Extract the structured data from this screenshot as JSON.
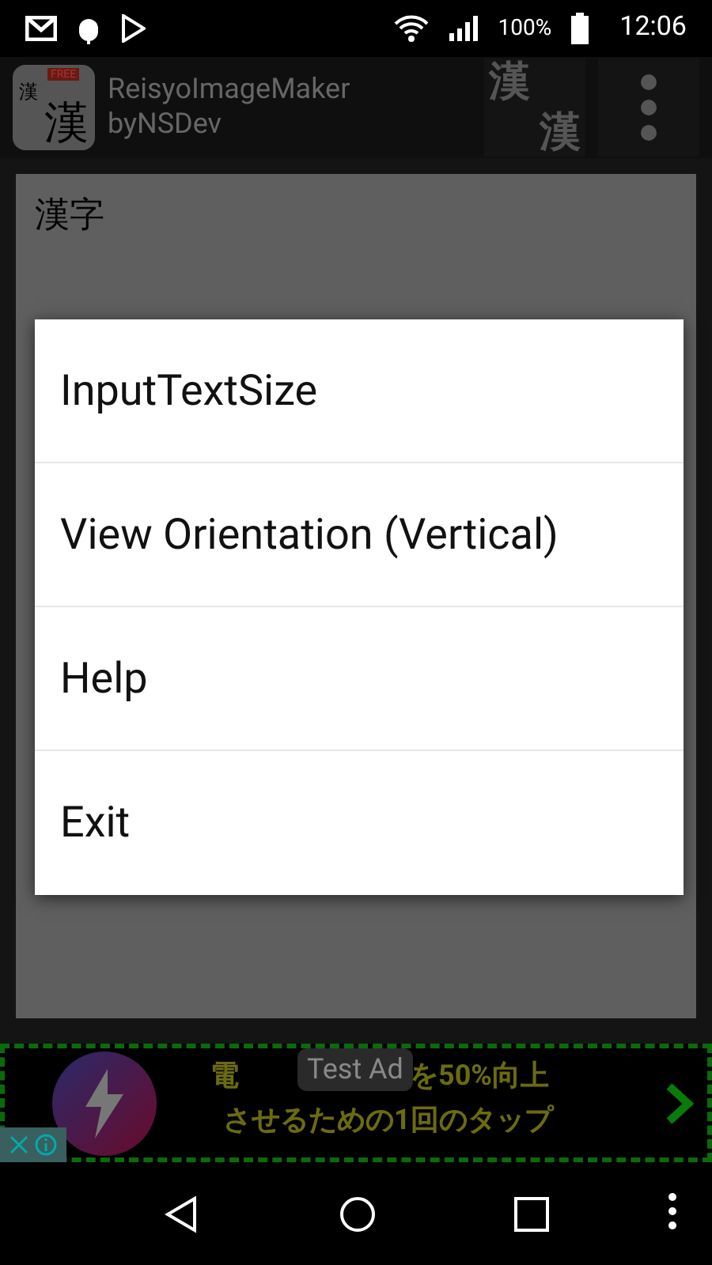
{
  "status_bar": {
    "battery_text": "100%",
    "time": "12:06"
  },
  "action_bar": {
    "app_icon": {
      "badge": "FREE",
      "small_char": "漢",
      "big_char": "漢"
    },
    "title": "ReisyoImageMaker",
    "subtitle": "byNSDev",
    "convert_button": {
      "top_char": "漢",
      "bottom_char": "漢"
    }
  },
  "editor": {
    "value": "漢字"
  },
  "menu": {
    "items": [
      {
        "label": "InputTextSize"
      },
      {
        "label": "View Orientation (Vertical)"
      },
      {
        "label": "Help"
      },
      {
        "label": "Exit"
      }
    ]
  },
  "ad": {
    "badge": "Test Ad",
    "line1_start": "電",
    "line1_end": "を50%向上",
    "line2": "させるための1回のタップ"
  }
}
